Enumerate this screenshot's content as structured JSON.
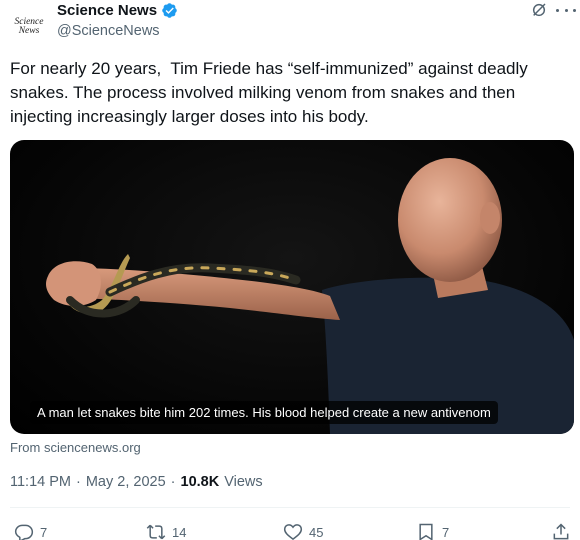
{
  "account": {
    "avatar_line1": "Science",
    "avatar_line2": "News",
    "display_name": "Science News",
    "handle": "@ScienceNews"
  },
  "tweet": {
    "text": "For nearly 20 years,  Tim Friede has “self-immunized” against deadly snakes. The process involved milking venom from snakes and then injecting increasingly larger doses into his body."
  },
  "media": {
    "caption": "A man let snakes bite him 202 times. His blood helped create a new antivenom",
    "source": "From sciencenews.org"
  },
  "meta": {
    "time": "11:14 PM",
    "separator": "·",
    "date": "May 2, 2025",
    "views_count": "10.8K",
    "views_label": "Views"
  },
  "actions": {
    "replies": "7",
    "reposts": "14",
    "likes": "45",
    "bookmarks": "7"
  },
  "colors": {
    "verified_blue": "#1d9bf0",
    "secondary_text": "#536471"
  },
  "icons": [
    "verified-badge-icon",
    "grok-icon",
    "more-icon",
    "reply-icon",
    "repost-icon",
    "like-icon",
    "bookmark-icon",
    "share-icon"
  ]
}
